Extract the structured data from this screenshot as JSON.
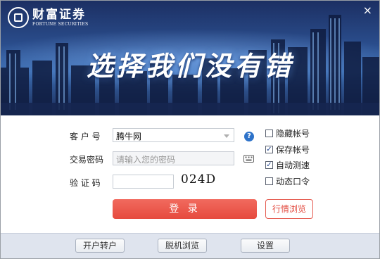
{
  "brand": {
    "name_cn": "财富证券",
    "name_en": "FORTUNE SECURITIES"
  },
  "window": {
    "close_glyph": "×"
  },
  "banner": {
    "slogan": "选择我们没有错"
  },
  "form": {
    "account": {
      "label": "客 户 号",
      "value": "腾牛网",
      "help_glyph": "?"
    },
    "password": {
      "label": "交易密码",
      "placeholder": "请输入您的密码"
    },
    "captcha": {
      "label": "验 证 码",
      "value": "",
      "code": "024D"
    }
  },
  "options": [
    {
      "label": "隐藏帐号",
      "checked": false
    },
    {
      "label": "保存帐号",
      "checked": true
    },
    {
      "label": "自动测速",
      "checked": true
    },
    {
      "label": "动态口令",
      "checked": false
    }
  ],
  "buttons": {
    "login": "登 录",
    "quotes": "行情浏览"
  },
  "bottom": {
    "open_account": "开户转户",
    "offline_browse": "脱机浏览",
    "settings": "设置"
  },
  "colors": {
    "primary": "#e64a3e",
    "banner": "#2a4d8c",
    "accent": "#1b3f8b"
  }
}
